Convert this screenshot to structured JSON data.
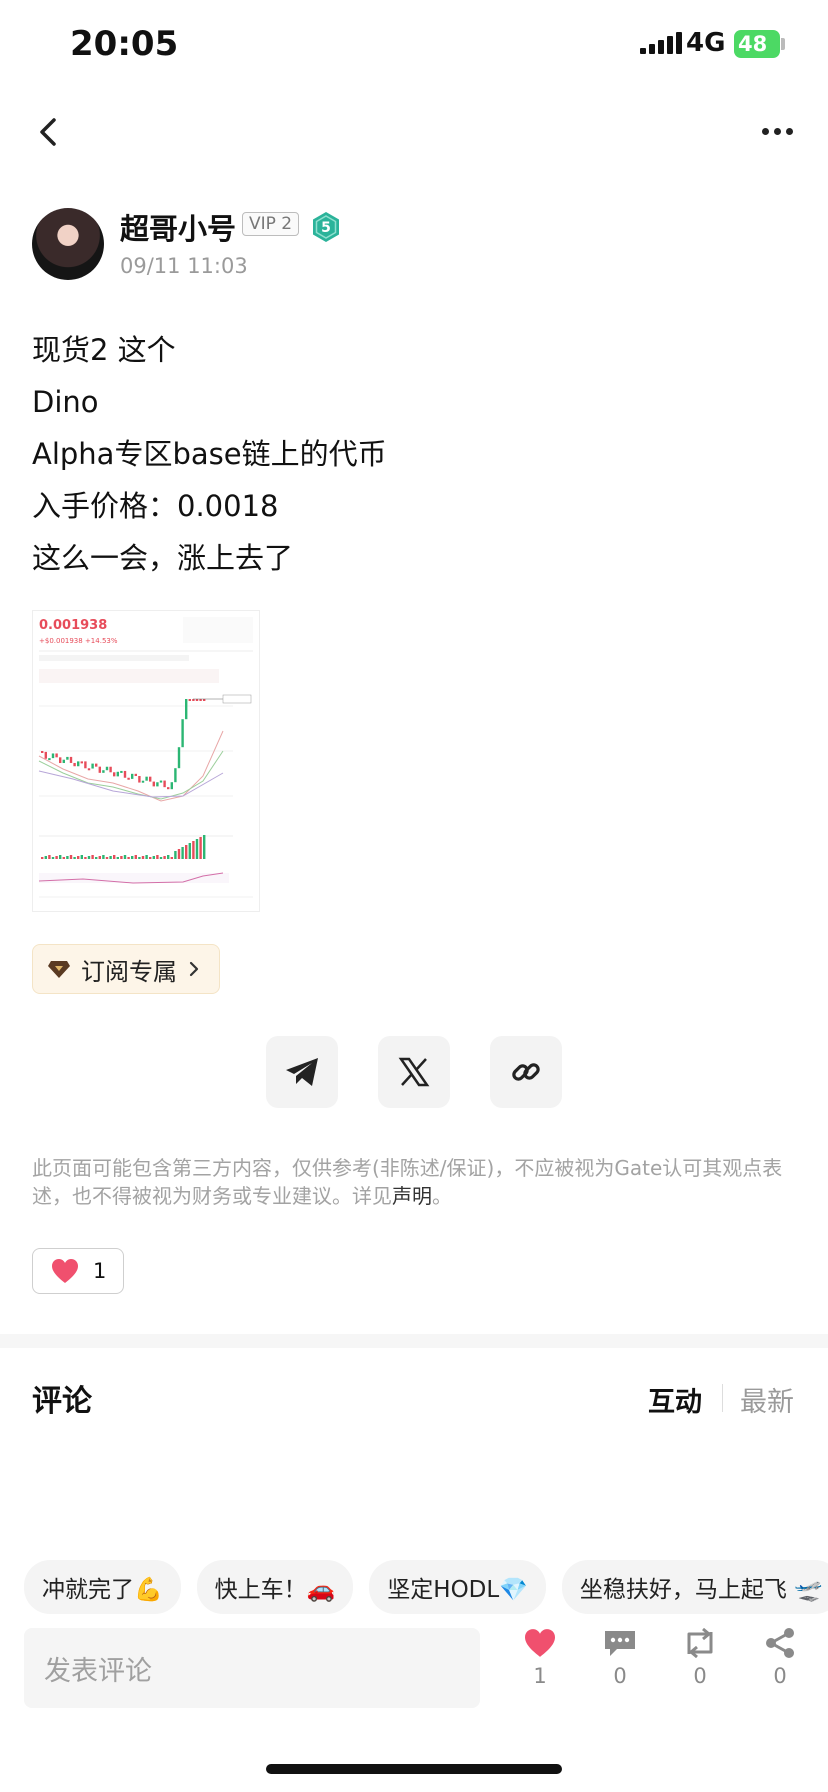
{
  "status_bar": {
    "time": "20:05",
    "network": "4G",
    "battery": "48"
  },
  "author": {
    "name": "超哥小号",
    "vip": "VIP 2",
    "level": "5",
    "date": "09/11 11:03"
  },
  "post": {
    "lines": [
      "现货2 这个",
      "Dino",
      "Alpha专区base链上的代币",
      "入手价格：0.0018",
      "这么一会，涨上去了"
    ]
  },
  "chart": {
    "price": "0.001938",
    "change": "+$0.001938 +14.53%"
  },
  "subscribe": {
    "label": "订阅专属"
  },
  "disclaimer": {
    "text": "此页面可能包含第三方内容，仅供参考(非陈述/保证)，不应被视为Gate认可其观点表述，也不得被视为财务或专业建议。详见",
    "link": "声明",
    "end": "。"
  },
  "likes": {
    "count": "1"
  },
  "comments": {
    "title": "评论",
    "tab_interact": "互动",
    "tab_latest": "最新"
  },
  "quick_replies": [
    "冲就完了💪",
    "快上车！🚗",
    "坚定HODL💎",
    "坐稳扶好，马上起飞 🛫"
  ],
  "input": {
    "placeholder": "发表评论"
  },
  "actions": {
    "like": "1",
    "comment": "0",
    "repost": "0",
    "share": "0"
  },
  "colors": {
    "heart": "#f0506e",
    "up": "#2bb673",
    "down": "#e74c5a",
    "level": "#2bb39a"
  }
}
